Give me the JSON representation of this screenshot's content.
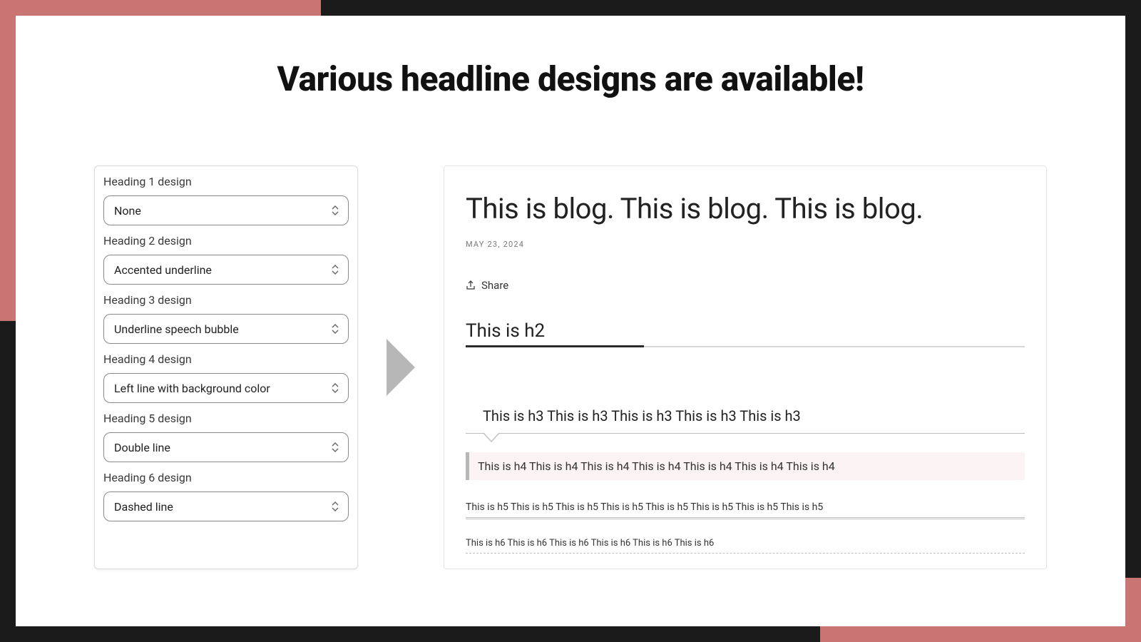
{
  "title": "Various headline designs are available!",
  "settings": {
    "fields": [
      {
        "label": "Heading 1 design",
        "value": "None"
      },
      {
        "label": "Heading 2 design",
        "value": "Accented underline"
      },
      {
        "label": "Heading 3 design",
        "value": "Underline speech bubble"
      },
      {
        "label": "Heading 4 design",
        "value": "Left line with background color"
      },
      {
        "label": "Heading 5 design",
        "value": "Double line"
      },
      {
        "label": "Heading 6 design",
        "value": "Dashed line"
      }
    ]
  },
  "preview": {
    "blog_title": "This is blog. This is blog. This is blog.",
    "date": "MAY 23, 2024",
    "share_label": "Share",
    "h2": "This is h2",
    "h3": "This is h3 This is h3 This is h3 This is h3 This is h3",
    "h4": "This is h4 This is h4 This is h4 This is h4 This is h4 This is h4 This is h4",
    "h5": "This is h5 This is h5 This is h5 This is h5 This is h5 This is h5 This is h5 This is h5",
    "h6": "This is h6 This is h6 This is h6 This is h6 This is h6 This is h6"
  }
}
